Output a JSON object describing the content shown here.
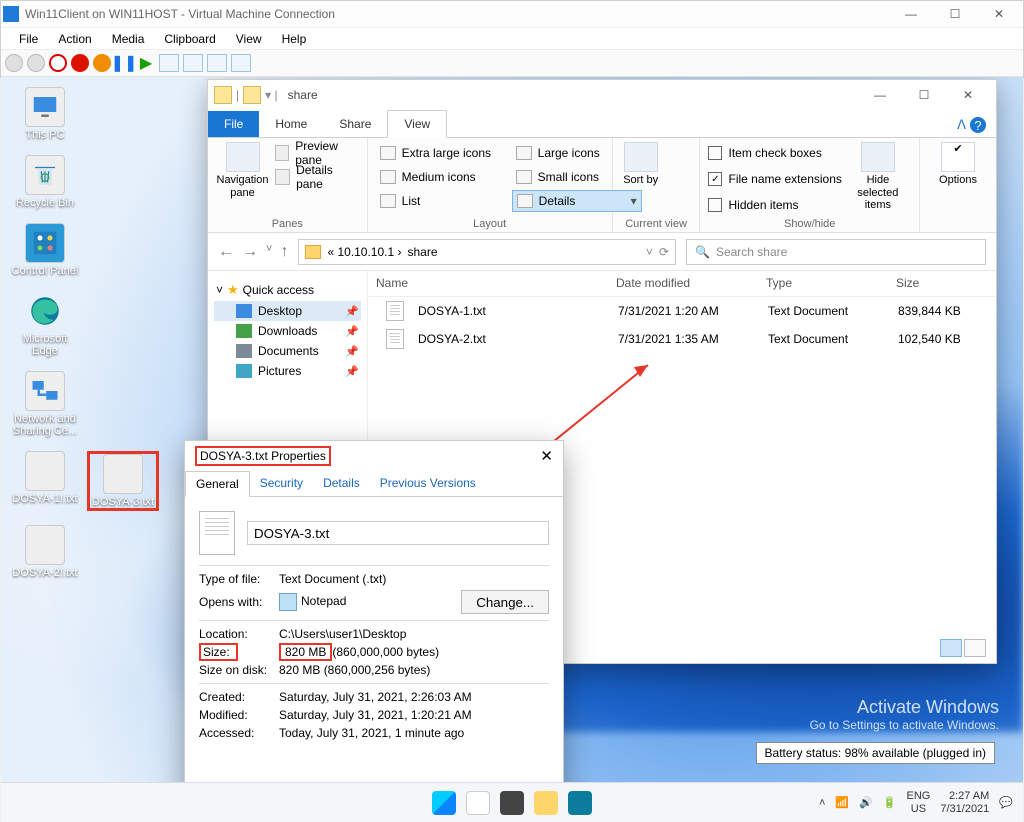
{
  "vm": {
    "title": "Win11Client on WIN11HOST - Virtual Machine Connection",
    "menus": [
      "File",
      "Action",
      "Media",
      "Clipboard",
      "View",
      "Help"
    ],
    "winbtns": {
      "min": "—",
      "max": "☐",
      "close": "✕"
    }
  },
  "desktop": {
    "icons": {
      "this_pc": "This PC",
      "recycle": "Recycle Bin",
      "cpanel": "Control Panel",
      "edge": "Microsoft Edge",
      "netshare": "Network and Sharing Ce...",
      "file1": "DOSYA-1!.txt",
      "file3": "DOSYA-3.txt",
      "file2": "DOSYA-2!.txt"
    }
  },
  "explorer": {
    "title": "share",
    "tabs": {
      "file": "File",
      "home": "Home",
      "share": "Share",
      "view": "View"
    },
    "ribbon": {
      "panes": {
        "nav": "Navigation pane",
        "preview": "Preview pane",
        "details": "Details pane",
        "group": "Panes"
      },
      "layout": {
        "xl": "Extra large icons",
        "l": "Large icons",
        "m": "Medium icons",
        "s": "Small icons",
        "list": "List",
        "details": "Details",
        "group": "Layout"
      },
      "curview": {
        "sort": "Sort by",
        "group": "Current view"
      },
      "showhide": {
        "itemchk": "Item check boxes",
        "ext": "File name extensions",
        "hidden": "Hidden items",
        "hidebtn": "Hide selected items",
        "group": "Show/hide"
      },
      "options": "Options"
    },
    "addr": {
      "path_prefix": "« 10.10.10.1 ›",
      "path": "share",
      "refresh": "⟳"
    },
    "search_placeholder": "Search share",
    "nav": {
      "quick": "Quick access",
      "desktop": "Desktop",
      "downloads": "Downloads",
      "documents": "Documents",
      "pictures": "Pictures"
    },
    "columns": {
      "name": "Name",
      "date": "Date modified",
      "type": "Type",
      "size": "Size"
    },
    "files": [
      {
        "name": "DOSYA-1.txt",
        "date": "7/31/2021 1:20 AM",
        "type": "Text Document",
        "size": "839,844 KB"
      },
      {
        "name": "DOSYA-2.txt",
        "date": "7/31/2021 1:35 AM",
        "type": "Text Document",
        "size": "102,540 KB"
      }
    ]
  },
  "props": {
    "title": "DOSYA-3.txt Properties",
    "tabs": {
      "general": "General",
      "security": "Security",
      "details": "Details",
      "prev": "Previous Versions"
    },
    "filename": "DOSYA-3.txt",
    "typeof_k": "Type of file:",
    "typeof_v": "Text Document (.txt)",
    "opens_k": "Opens with:",
    "opens_v": "Notepad",
    "change": "Change...",
    "loc_k": "Location:",
    "loc_v": "C:\\Users\\user1\\Desktop",
    "size_k": "Size:",
    "size_v": "820 MB",
    "size_bytes": "(860,000,000 bytes)",
    "disk_k": "Size on disk:",
    "disk_v": "820 MB (860,000,256 bytes)",
    "created_k": "Created:",
    "created_v": "Saturday, July 31, 2021, 2:26:03 AM",
    "modified_k": "Modified:",
    "modified_v": "Saturday, July 31, 2021, 1:20:21 AM",
    "accessed_k": "Accessed:",
    "accessed_v": "Today, July 31, 2021, 1 minute ago"
  },
  "overlay": {
    "activate": "Activate Windows",
    "activate_sub": "Go to Settings to activate Windows.",
    "battery": "Battery status: 98% available (plugged in)"
  },
  "taskbar": {
    "lang1": "ENG",
    "lang2": "US",
    "time": "2:27 AM",
    "date": "7/31/2021"
  }
}
